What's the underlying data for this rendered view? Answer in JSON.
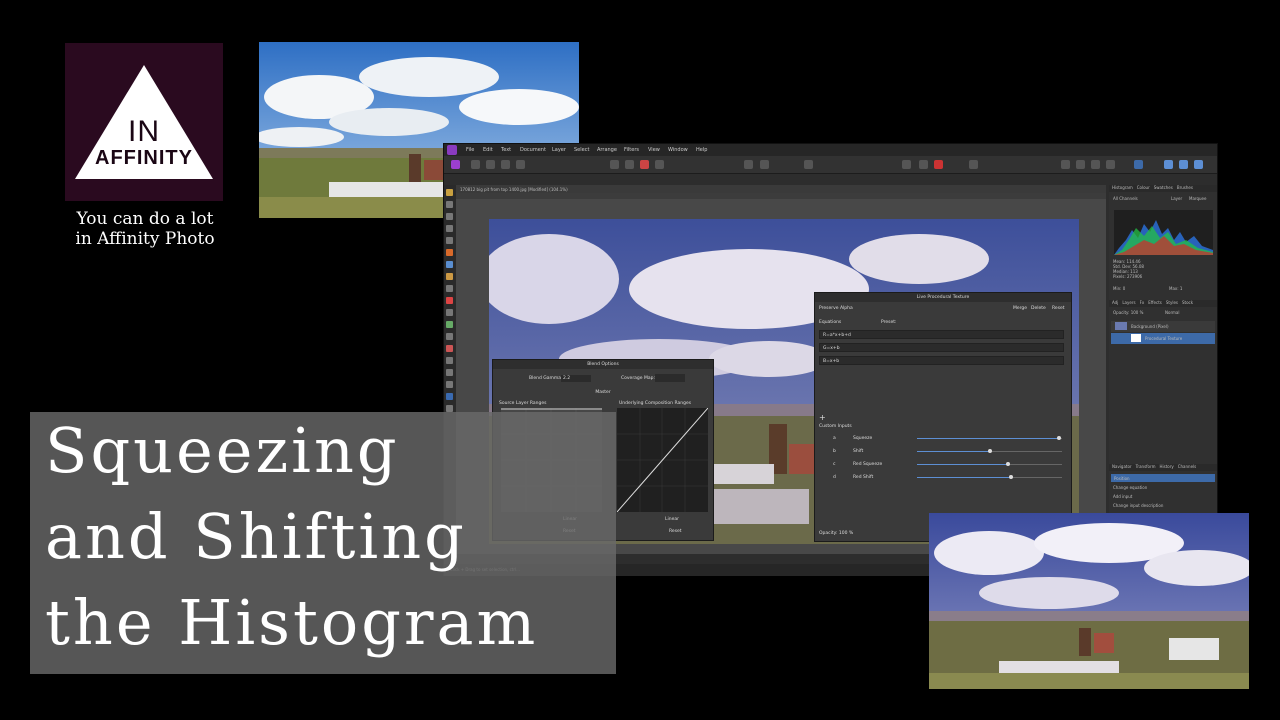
{
  "logo": {
    "line1": "IN",
    "line2": "AFFINITY"
  },
  "tagline": {
    "line1": "You can do a lot",
    "line2": "in Affinity Photo"
  },
  "title": {
    "line1": "Squeezing",
    "line2": "and Shifting",
    "line3": "the Histogram"
  },
  "app": {
    "menu": [
      "File",
      "Edit",
      "Text",
      "Document",
      "Layer",
      "Select",
      "Arrange",
      "Filters",
      "View",
      "Window",
      "Help"
    ],
    "doc_tab": "170812 big pit from top 1400.jpg [Modified] (104.1%)",
    "status": "Click + Drag to set selection, ctrl..."
  },
  "right_panel": {
    "tabs_top": [
      "Histogram",
      "Colour",
      "Swatches",
      "Brushes"
    ],
    "channels": "All Channels",
    "layer_label": "Layer",
    "marquee_label": "Marquee",
    "stats": [
      "Mean: 114.46",
      "Std. Dev: 56.08",
      "Median: 113",
      "Pixels: 273906"
    ],
    "min_label": "Min: 0",
    "max_label": "Max: 1",
    "tabs_mid": [
      "Adj",
      "Layers",
      "Fx",
      "Effects",
      "Styles",
      "Stock"
    ],
    "opacity": "Opacity: 100 %",
    "blend": "Normal",
    "layers": [
      "Background (Pixel)",
      "Procedural Texture"
    ],
    "tabs_bottom": [
      "Navigator",
      "Transform",
      "History",
      "Channels"
    ],
    "history": [
      "Position",
      "Change equation",
      "Add input",
      "Change input description"
    ]
  },
  "blend_options": {
    "title": "Blend Options",
    "gamma_label": "Blend Gamma:",
    "gamma_value": "2.2",
    "coverage_label": "Coverage Map:",
    "channel": "Master",
    "source_label": "Source Layer Ranges",
    "underlying_label": "Underlying Composition Ranges",
    "linear": "Linear",
    "reset": "Reset"
  },
  "lpt": {
    "title": "Live Procedural Texture",
    "preserve_alpha": "Preserve Alpha",
    "merge": "Merge",
    "delete": "Delete",
    "reset": "Reset",
    "equations_label": "Equations",
    "preset_label": "Preset:",
    "equations": [
      "R=a*x+b+d",
      "G=x+b",
      "B=x+b"
    ],
    "custom_inputs": "Custom Inputs",
    "inputs": [
      {
        "id": "a",
        "name": "Squeeze",
        "value": 0.98
      },
      {
        "id": "b",
        "name": "Shift",
        "value": 0.5
      },
      {
        "id": "c",
        "name": "Red Squeeze",
        "value": 0.63
      },
      {
        "id": "d",
        "name": "Red Shift",
        "value": 0.65
      }
    ],
    "opacity": "Opacity: 100 %"
  },
  "colors": {
    "accent": "#5d8fd4",
    "brand": "#2a0a1f",
    "app_bg": "#2d2d2d"
  }
}
